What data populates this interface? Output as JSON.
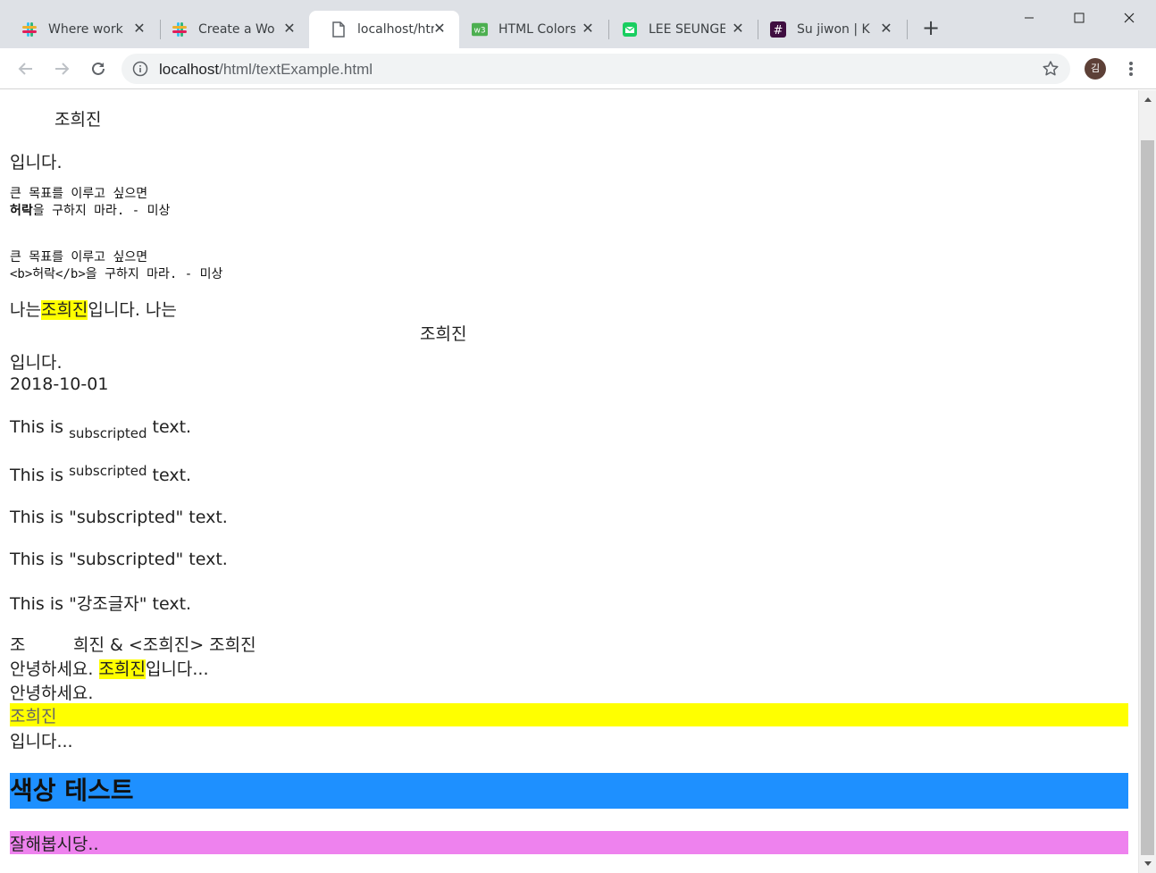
{
  "browser": {
    "tabs": [
      {
        "title": "Where work",
        "icon": "slack-icon"
      },
      {
        "title": "Create a Wo",
        "icon": "slack-icon"
      },
      {
        "title": "localhost/htm",
        "icon": "page-icon",
        "active": true
      },
      {
        "title": "HTML Colors",
        "icon": "w3schools-icon"
      },
      {
        "title": "LEE SEUNGE",
        "icon": "mail-icon"
      },
      {
        "title": "Su jiwon | K",
        "icon": "hash-icon"
      }
    ],
    "url_host": "localhost",
    "url_path": "/html/textExample.html",
    "avatar_initial": "김"
  },
  "content": {
    "line1_name": "조희진",
    "line2": "입니다.",
    "pre1_line1": "큰 목표를 이루고 싶으면",
    "pre1_bold": "허락",
    "pre1_line2_rest": "을 구하지 마라. - 미상",
    "pre2_line1": "큰 목표를 이루고 싶으면",
    "pre2_line2": "<b>허락</b>을 구하지 마라. - 미상",
    "row_a_prefix": "나는",
    "row_a_mark": "조희진",
    "row_a_suffix": "입니다. 나는",
    "row_b_center": "조희진",
    "row_c": "입니다.",
    "date": "2018-10-01",
    "sub_prefix": "This is",
    "sub_word": "subscripted",
    "sub_suffix": "text.",
    "sup_prefix": "This is",
    "sup_word": "subscripted",
    "sup_suffix": "text.",
    "quote1": "This is \"subscripted\" text.",
    "quote2": "This is \"subscripted\" text.",
    "quote3": "This is \"강조글자\" text.",
    "entity_a": "조",
    "entity_b": "희진 & <조희진> 조희진",
    "hello_prefix": "안녕하세요.",
    "hello_mark": "조희진",
    "hello_suffix": "입니다...",
    "hello2": "안녕하세요.",
    "block_mark": "조희진",
    "block_after": "입니다...",
    "heading": "색상 테스트",
    "footer_text": "잘해봅시당.."
  },
  "colors": {
    "highlight": "#ffff00",
    "heading_bg": "#1e90ff",
    "footer_bg": "#ee82ee"
  }
}
